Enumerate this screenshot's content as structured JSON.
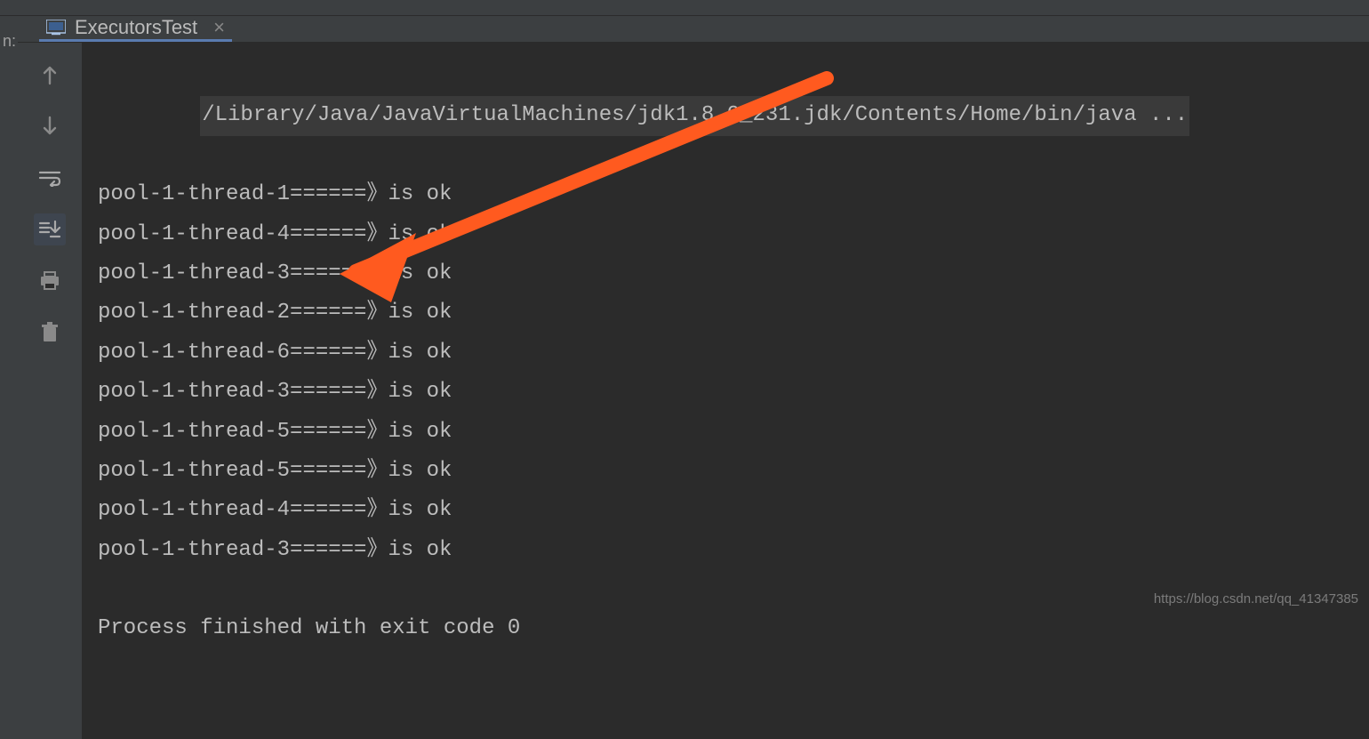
{
  "left_label": "n:",
  "tab": {
    "title": "ExecutorsTest"
  },
  "console": {
    "command": "/Library/Java/JavaVirtualMachines/jdk1.8.0_231.jdk/Contents/Home/bin/java ...",
    "lines": [
      "pool-1-thread-1======》is ok",
      "pool-1-thread-4======》is ok",
      "pool-1-thread-3======》is ok",
      "pool-1-thread-2======》is ok",
      "pool-1-thread-6======》is ok",
      "pool-1-thread-3======》is ok",
      "pool-1-thread-5======》is ok",
      "pool-1-thread-5======》is ok",
      "pool-1-thread-4======》is ok",
      "pool-1-thread-3======》is ok"
    ],
    "footer": "Process finished with exit code 0"
  },
  "watermark": "https://blog.csdn.net/qq_41347385",
  "annotation": {
    "color": "#ff5a1f"
  }
}
